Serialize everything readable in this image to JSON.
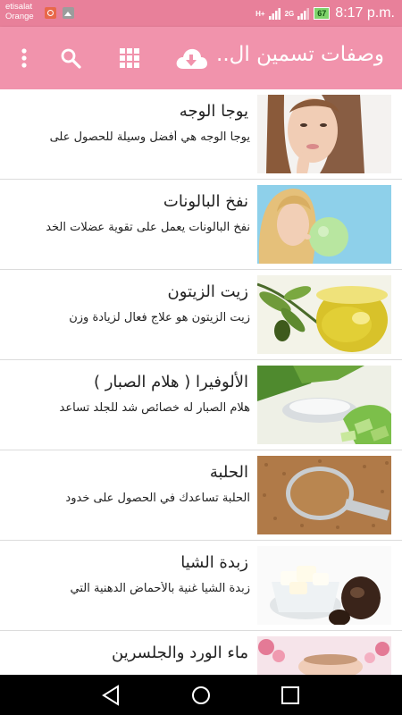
{
  "status": {
    "carrier_line1": "etisalat",
    "carrier_line2": "Orange",
    "network_h": "H+",
    "network_2g": "2G",
    "battery": "67",
    "time": "8:17 p.m."
  },
  "toolbar": {
    "title": "وصفات تسمين ال..",
    "icons": [
      "more-vert-icon",
      "search-icon",
      "grid-icon",
      "download-icon"
    ]
  },
  "recipes": [
    {
      "title": "يوجا الوجه",
      "desc": "يوجا الوجه هي أفضل وسيلة للحصول على"
    },
    {
      "title": "نفخ البالونات",
      "desc": "نفخ البالونات يعمل على تقوية عضلات الخد"
    },
    {
      "title": "زيت الزيتون",
      "desc": "زيت الزيتون هو علاج فعال لزيادة وزن"
    },
    {
      "title": "الألوفيرا ( هلام الصبار )",
      "desc": "هلام الصبار له خصائص شد للجلد تساعد"
    },
    {
      "title": "الحلبة",
      "desc": "الحلبة تساعدك في الحصول على خدود"
    },
    {
      "title": "زبدة الشيا",
      "desc": "زبدة الشيا غنية بالأحماض الدهنية التي"
    },
    {
      "title": "ماء الورد والجلسرين",
      "desc": ""
    }
  ],
  "colors": {
    "toolbar": "#f193ac",
    "status_bar": "#e8809a",
    "nav_bar": "#000000"
  }
}
